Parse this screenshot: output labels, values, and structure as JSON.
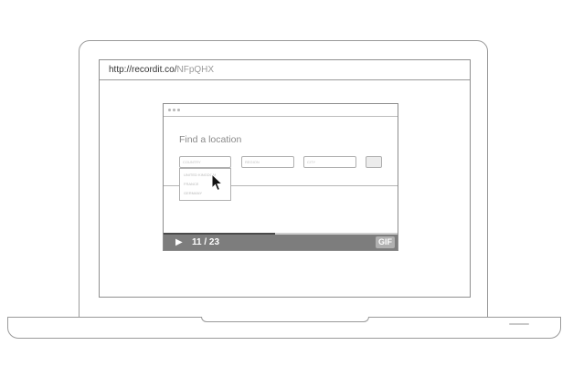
{
  "address_bar": {
    "domain": "http://recordit.co/",
    "path": "NFpQHX"
  },
  "recording": {
    "form_title": "Find a location",
    "fields": [
      "COUNTRY",
      "REGION",
      "CITY"
    ],
    "dropdown_options": [
      "UNITED KINGDOM",
      "FRANCE",
      "GERMANY"
    ],
    "player": {
      "play_icon": "▶",
      "counter": "11 / 23",
      "current_frame": 11,
      "total_frames": 23,
      "gif_label": "GIF"
    }
  },
  "colors": {
    "control_bar": "#7d7d7d",
    "outline": "#9a9a9a"
  }
}
